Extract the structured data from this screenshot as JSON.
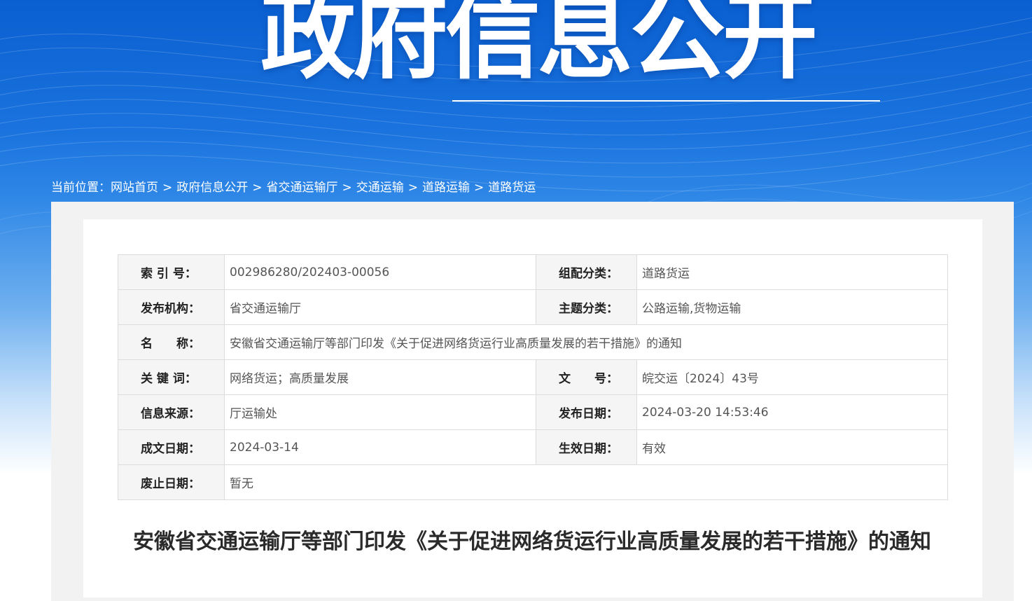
{
  "banner": {
    "title": "政府信息公开"
  },
  "breadcrumb": {
    "prefix": "当前位置：",
    "items": [
      "网站首页",
      "政府信息公开",
      "省交通运输厅",
      "交通运输",
      "道路运输",
      "道路货运"
    ],
    "separator": ">"
  },
  "info": {
    "index_label": "索 引 号：",
    "index_value": "002986280/202403-00056",
    "category_label": "组配分类：",
    "category_value": "道路货运",
    "publisher_label": "发布机构：",
    "publisher_value": "省交通运输厅",
    "topic_label": "主题分类：",
    "topic_value": "公路运输,货物运输",
    "name_label": "名　　称：",
    "name_value": "安徽省交通运输厅等部门印发《关于促进网络货运行业高质量发展的若干措施》的通知",
    "keywords_label": "关 键 词：",
    "keywords_value": "网络货运；高质量发展",
    "docno_label": "文　　号：",
    "docno_value": "皖交运〔2024〕43号",
    "source_label": "信息来源：",
    "source_value": "厅运输处",
    "pubdate_label": "发布日期：",
    "pubdate_value": "2024-03-20 14:53:46",
    "written_label": "成文日期：",
    "written_value": "2024-03-14",
    "effective_label": "生效日期：",
    "effective_value": "有效",
    "abolish_label": "废止日期：",
    "abolish_value": "暂无"
  },
  "article": {
    "title": "安徽省交通运输厅等部门印发《关于促进网络货运行业高质量发展的若干措施》的通知"
  },
  "colors": {
    "banner_blue": "#1a73de",
    "panel_gray": "#f2f2f2",
    "label_bg": "#f5f5f5"
  }
}
